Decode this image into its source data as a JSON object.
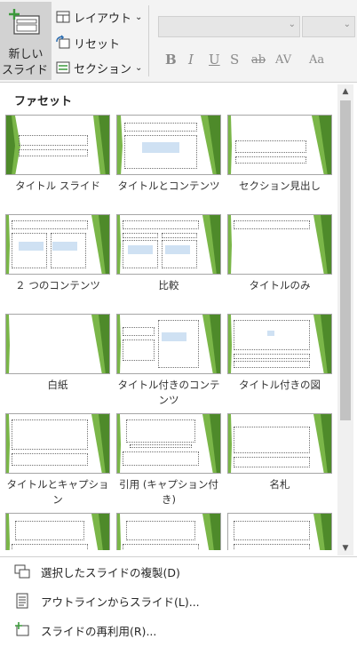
{
  "ribbon": {
    "new_slide_line1": "新しい",
    "new_slide_line2": "スライド",
    "layout_label": "レイアウト",
    "reset_label": "リセット",
    "section_label": "セクション",
    "font_size_placeholder": "",
    "format_bold": "B",
    "format_italic": "I",
    "format_underline": "U",
    "format_shadow": "S",
    "format_strike": "ab",
    "format_spacing": "AV",
    "format_case": "Aa"
  },
  "panel": {
    "section_title": "ファセット",
    "layouts": [
      {
        "label": "タイトル スライド"
      },
      {
        "label": "タイトルとコンテンツ"
      },
      {
        "label": "セクション見出し"
      },
      {
        "label": "２ つのコンテンツ"
      },
      {
        "label": "比較"
      },
      {
        "label": "タイトルのみ"
      },
      {
        "label": "白紙"
      },
      {
        "label": "タイトル付きのコンテンツ"
      },
      {
        "label": "タイトル付きの図"
      },
      {
        "label": "タイトルとキャプション"
      },
      {
        "label": "引用 (キャプション付き)"
      },
      {
        "label": "名札"
      }
    ]
  },
  "menu": {
    "duplicate": "選択したスライドの複製(D)",
    "from_outline": "アウトラインからスライド(L)...",
    "reuse": "スライドの再利用(R)..."
  },
  "colors": {
    "accent_green": "#7ab648",
    "dark_green": "#4e8a2a"
  }
}
